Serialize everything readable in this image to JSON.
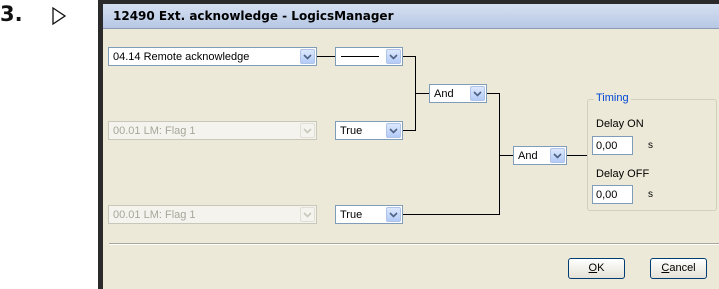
{
  "step": {
    "number": "3.",
    "marker_icon": "triangle-right-outline"
  },
  "window": {
    "title": "12490 Ext. acknowledge - LogicsManager"
  },
  "inputs": [
    {
      "source": "04.14 Remote acknowledge",
      "enabled": true,
      "operator_icon": "line-symbol"
    },
    {
      "source": "00.01 LM: Flag 1",
      "enabled": false,
      "operator": "True"
    },
    {
      "source": "00.01 LM: Flag 1",
      "enabled": false,
      "operator": "True"
    }
  ],
  "gates": {
    "gate1": "And",
    "gate2": "And"
  },
  "timing": {
    "label": "Timing",
    "delay_on_label": "Delay ON",
    "delay_on_value": "0,00",
    "delay_on_unit": "s",
    "delay_off_label": "Delay OFF",
    "delay_off_value": "0,00",
    "delay_off_unit": "s"
  },
  "buttons": {
    "ok_mnemonic": "O",
    "ok_rest": "K",
    "cancel_mnemonic": "C",
    "cancel_rest": "ancel"
  },
  "colors": {
    "disabled_text": "#a7a69a",
    "groupbox_label": "#0046d5",
    "dialog_face": "#ece9d8"
  }
}
